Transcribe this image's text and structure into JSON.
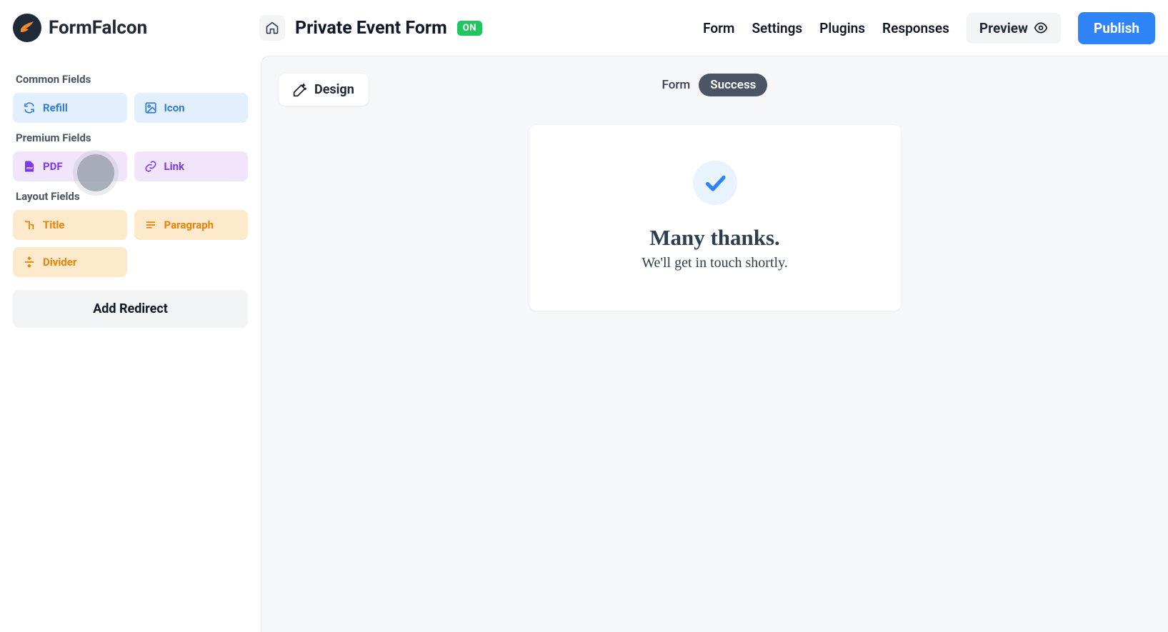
{
  "app": {
    "name": "FormFalcon"
  },
  "header": {
    "form_title": "Private Event Form",
    "status_badge": "ON",
    "nav": {
      "form": "Form",
      "settings": "Settings",
      "plugins": "Plugins",
      "responses": "Responses",
      "preview": "Preview",
      "publish": "Publish"
    }
  },
  "sidebar": {
    "sections": {
      "common": {
        "label": "Common Fields",
        "items": {
          "refill": "Refill",
          "icon": "Icon"
        }
      },
      "premium": {
        "label": "Premium Fields",
        "items": {
          "pdf": "PDF",
          "link": "Link"
        }
      },
      "layout": {
        "label": "Layout Fields",
        "items": {
          "title": "Title",
          "paragraph": "Paragraph",
          "divider": "Divider"
        }
      }
    },
    "add_redirect": "Add Redirect"
  },
  "canvas": {
    "design_btn": "Design",
    "view_toggle": {
      "form": "Form",
      "success": "Success"
    },
    "success_card": {
      "title": "Many thanks.",
      "subtitle": "We'll get in touch shortly."
    }
  }
}
